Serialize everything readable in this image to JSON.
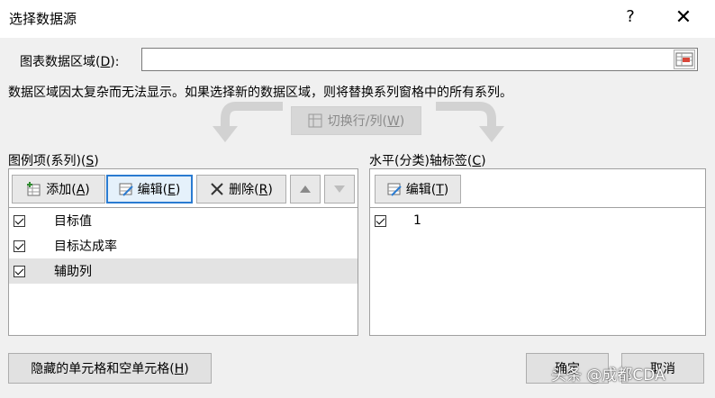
{
  "dialog": {
    "title": "选择数据源",
    "help": "?",
    "close": "✕"
  },
  "range": {
    "label_prefix": "图表数据区域(",
    "label_key": "D",
    "label_suffix": "):",
    "value": ""
  },
  "info_text": "数据区域因太复杂而无法显示。如果选择新的数据区域，则将替换系列窗格中的所有系列。",
  "switch_button": {
    "prefix": "切换行/列(",
    "key": "W",
    "suffix": ")"
  },
  "series_panel": {
    "heading_prefix": "图例项(系列)(",
    "heading_key": "S",
    "heading_suffix": ")",
    "add": {
      "prefix": "添加(",
      "key": "A",
      "suffix": ")"
    },
    "edit": {
      "prefix": "编辑(",
      "key": "E",
      "suffix": ")"
    },
    "delete": {
      "prefix": "删除(",
      "key": "R",
      "suffix": ")"
    },
    "items": [
      {
        "label": "目标值",
        "checked": true
      },
      {
        "label": "目标达成率",
        "checked": true
      },
      {
        "label": "辅助列",
        "checked": true
      }
    ]
  },
  "axis_panel": {
    "heading_prefix": "水平(分类)轴标签(",
    "heading_key": "C",
    "heading_suffix": ")",
    "edit": {
      "prefix": "编辑(",
      "key": "T",
      "suffix": ")"
    },
    "items": [
      {
        "label": "1",
        "checked": true
      }
    ]
  },
  "footer": {
    "hidden_cells": {
      "prefix": "隐藏的单元格和空单元格(",
      "key": "H",
      "suffix": ")"
    },
    "ok": "确定",
    "cancel": "取消"
  },
  "watermark": "头条 @成都CDA",
  "icons": [
    "help-icon",
    "close-icon",
    "range-select-icon",
    "switch-icon",
    "add-icon",
    "edit-icon",
    "delete-icon",
    "up-arrow-icon",
    "down-arrow-icon"
  ]
}
